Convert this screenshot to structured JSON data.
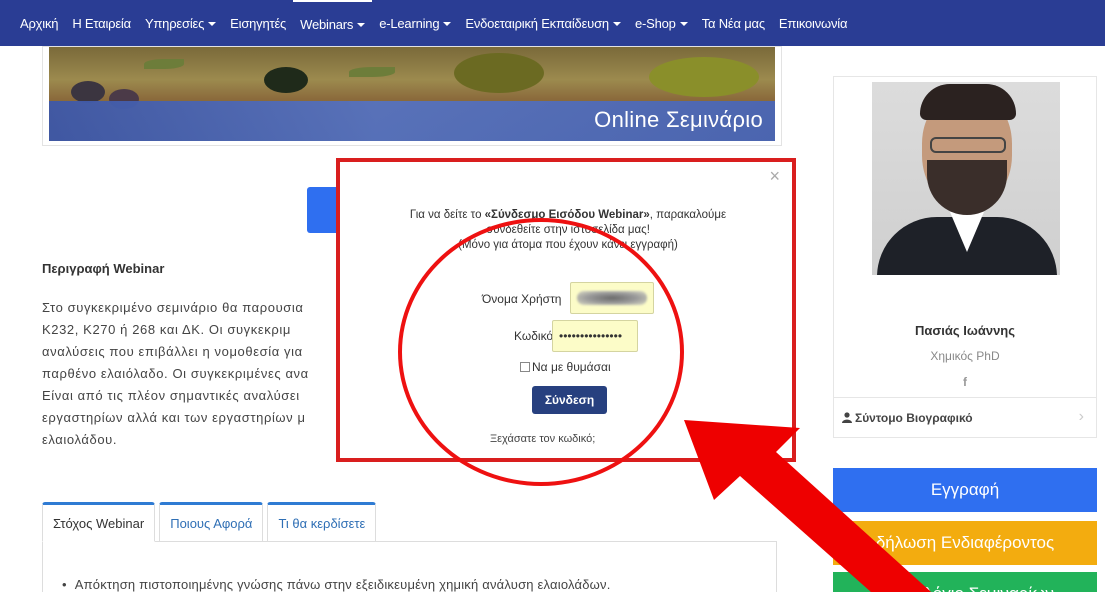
{
  "nav": {
    "items": [
      {
        "label": "Αρχική",
        "caret": false
      },
      {
        "label": "Η Εταιρεία",
        "caret": false
      },
      {
        "label": "Υπηρεσίες",
        "caret": true
      },
      {
        "label": "Εισηγητές",
        "caret": false
      },
      {
        "label": "Webinars",
        "caret": true
      },
      {
        "label": "e-Learning",
        "caret": true
      },
      {
        "label": "Ενδοεταιρική Εκπαίδευση",
        "caret": true
      },
      {
        "label": "e-Shop",
        "caret": true
      },
      {
        "label": "Τα Νέα μας",
        "caret": false
      },
      {
        "label": "Επικοινωνία",
        "caret": false
      }
    ],
    "bg_color": "#2a3d94"
  },
  "banner": {
    "title": "Online Σεμινάριο"
  },
  "main": {
    "section_title": "Περιγραφή Webinar",
    "description_lines": [
      "Στο συγκεκριμένο σεμινάριο θα παρουσια",
      "Κ232, Κ270 ή 268 και ΔΚ. Οι συγκεκριμ",
      "αναλύσεις που επιβάλλει η νομοθεσία για",
      "παρθένο ελαιόλαδο. Οι συγκεκριμένες ανα",
      "Είναι από τις πλέον σημαντικές αναλύσει",
      "εργαστηρίων αλλά και των εργαστηρίων μ",
      "ελαιολάδου."
    ],
    "tabs": [
      "Στόχος Webinar",
      "Ποιους Αφορά",
      "Τι θα κερδίσετε"
    ],
    "bullet": "Απόκτηση πιστοποιημένης γνώσης πάνω στην εξειδικευμένη χημική ανάλυση ελαιολάδων."
  },
  "sidebar": {
    "name": "Πασιάς Ιωάννης",
    "title": "Χημικός PhD",
    "facebook": "f",
    "bio_label": "Σύντομο Βιογραφικό",
    "bio_chevron": "›",
    "buttons": {
      "register": "Εγγραφή",
      "interest": "δήλωση Ενδιαφέροντος",
      "calendar": "Ημερολόγιο Σεμιναρίων"
    },
    "colors": {
      "register": "#2f6ff0",
      "interest": "#f3ac0f",
      "calendar": "#22b35a"
    }
  },
  "modal": {
    "close": "×",
    "text_prefix": "Για να δείτε το ",
    "text_bold": "«Σύνδεσμο Εισόδου Webinar»",
    "text_suffix": ", παρακαλούμε",
    "text_line2": "συνδεθείτε στην ιστοσελίδα μας!",
    "text_line3": "(Μόνο για άτομα που έχουν κάνει εγγραφή)",
    "username_label": "Όνομα Χρήστη",
    "password_label": "Κωδικός",
    "password_value": "•••••••••••••••",
    "remember_label": "Να με θυμάσαι",
    "submit_label": "Σύνδεση",
    "forgot_label": "Ξεχάσατε τον κωδικό;",
    "border_color": "#d91e1e"
  },
  "annotation": {
    "color": "#e11111"
  }
}
